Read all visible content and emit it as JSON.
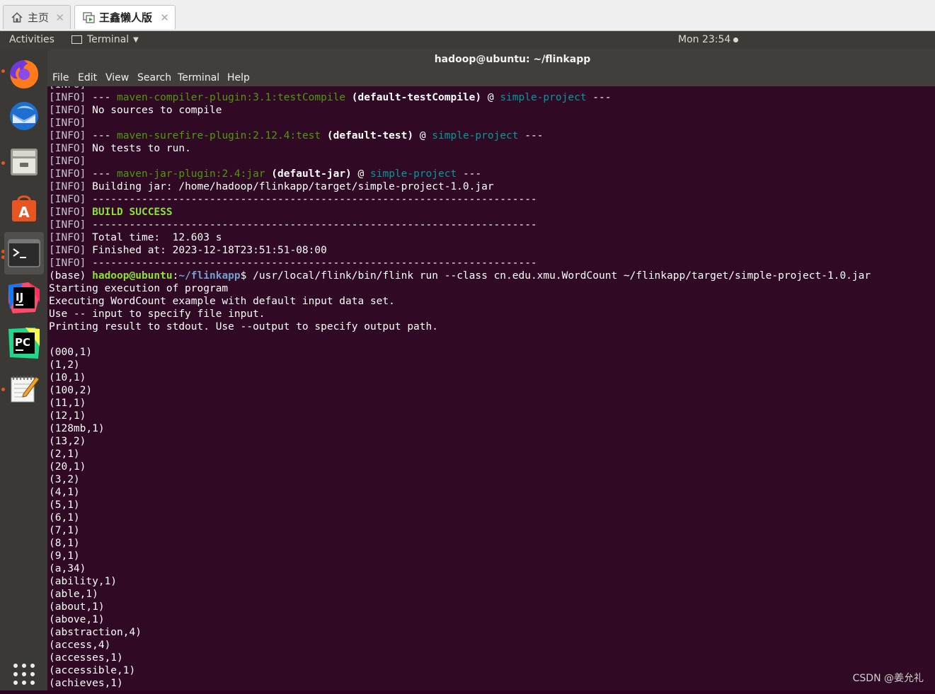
{
  "vm_tabs": [
    {
      "label": "主页",
      "icon": "home-icon",
      "active": false
    },
    {
      "label": "王鑫懒人版",
      "icon": "vm-icon",
      "active": true
    }
  ],
  "topbar": {
    "activities": "Activities",
    "app_name": "Terminal",
    "clock": "Mon 23:54"
  },
  "dock": [
    {
      "name": "firefox-icon",
      "running": true
    },
    {
      "name": "thunderbird-icon",
      "running": false
    },
    {
      "name": "files-icon",
      "running": true
    },
    {
      "name": "software-center-icon",
      "running": false
    },
    {
      "name": "terminal-icon",
      "running": true
    },
    {
      "name": "intellij-idea-icon",
      "running": false
    },
    {
      "name": "pycharm-icon",
      "running": false
    },
    {
      "name": "text-editor-icon",
      "running": true
    },
    {
      "name": "show-applications-icon",
      "running": false
    }
  ],
  "window": {
    "title": "hadoop@ubuntu: ~/flinkapp",
    "menu": [
      "File",
      "Edit",
      "View",
      "Search",
      "Terminal",
      "Help"
    ]
  },
  "terminal": {
    "lines": [
      [
        {
          "t": "[INFO]",
          "c": "info"
        }
      ],
      [
        {
          "t": "[INFO]",
          "c": "info"
        },
        {
          "t": " --- "
        },
        {
          "t": "maven-compiler-plugin:3.1:testCompile",
          "c": "green"
        },
        {
          "t": " "
        },
        {
          "t": "(default-testCompile)",
          "c": "bold"
        },
        {
          "t": " @ "
        },
        {
          "t": "simple-project",
          "c": "cyan"
        },
        {
          "t": " ---"
        }
      ],
      [
        {
          "t": "[INFO]",
          "c": "info"
        },
        {
          "t": " No sources to compile"
        }
      ],
      [
        {
          "t": "[INFO]",
          "c": "info"
        }
      ],
      [
        {
          "t": "[INFO]",
          "c": "info"
        },
        {
          "t": " --- "
        },
        {
          "t": "maven-surefire-plugin:2.12.4:test",
          "c": "green"
        },
        {
          "t": " "
        },
        {
          "t": "(default-test)",
          "c": "bold"
        },
        {
          "t": " @ "
        },
        {
          "t": "simple-project",
          "c": "cyan"
        },
        {
          "t": " ---"
        }
      ],
      [
        {
          "t": "[INFO]",
          "c": "info"
        },
        {
          "t": " No tests to run."
        }
      ],
      [
        {
          "t": "[INFO]",
          "c": "info"
        }
      ],
      [
        {
          "t": "[INFO]",
          "c": "info"
        },
        {
          "t": " --- "
        },
        {
          "t": "maven-jar-plugin:2.4:jar",
          "c": "green"
        },
        {
          "t": " "
        },
        {
          "t": "(default-jar)",
          "c": "bold"
        },
        {
          "t": " @ "
        },
        {
          "t": "simple-project",
          "c": "cyan"
        },
        {
          "t": " ---"
        }
      ],
      [
        {
          "t": "[INFO]",
          "c": "info"
        },
        {
          "t": " Building jar: /home/hadoop/flinkapp/target/simple-project-1.0.jar"
        }
      ],
      [
        {
          "t": "[INFO]",
          "c": "info"
        },
        {
          "t": " ------------------------------------------------------------------------"
        }
      ],
      [
        {
          "t": "[INFO]",
          "c": "info"
        },
        {
          "t": " "
        },
        {
          "t": "BUILD SUCCESS",
          "c": "succ"
        }
      ],
      [
        {
          "t": "[INFO]",
          "c": "info"
        },
        {
          "t": " ------------------------------------------------------------------------"
        }
      ],
      [
        {
          "t": "[INFO]",
          "c": "info"
        },
        {
          "t": " Total time:  12.603 s"
        }
      ],
      [
        {
          "t": "[INFO]",
          "c": "info"
        },
        {
          "t": " Finished at: 2023-12-18T23:51:51-08:00"
        }
      ],
      [
        {
          "t": "[INFO]",
          "c": "info"
        },
        {
          "t": " ------------------------------------------------------------------------"
        }
      ],
      [
        {
          "t": "(base) "
        },
        {
          "t": "hadoop@ubuntu",
          "c": "prompt-user"
        },
        {
          "t": ":"
        },
        {
          "t": "~/flinkapp",
          "c": "prompt-path"
        },
        {
          "t": "$ /usr/local/flink/bin/flink run --class cn.edu.xmu.WordCount ~/flinkapp/target/simple-project-1.0.jar"
        }
      ],
      [
        {
          "t": "Starting execution of program"
        }
      ],
      [
        {
          "t": "Executing WordCount example with default input data set."
        }
      ],
      [
        {
          "t": "Use -- input to specify file input."
        }
      ],
      [
        {
          "t": "Printing result to stdout. Use --output to specify output path."
        }
      ],
      [
        {
          "t": ""
        }
      ],
      [
        {
          "t": "(000,1)"
        }
      ],
      [
        {
          "t": "(1,2)"
        }
      ],
      [
        {
          "t": "(10,1)"
        }
      ],
      [
        {
          "t": "(100,2)"
        }
      ],
      [
        {
          "t": "(11,1)"
        }
      ],
      [
        {
          "t": "(12,1)"
        }
      ],
      [
        {
          "t": "(128mb,1)"
        }
      ],
      [
        {
          "t": "(13,2)"
        }
      ],
      [
        {
          "t": "(2,1)"
        }
      ],
      [
        {
          "t": "(20,1)"
        }
      ],
      [
        {
          "t": "(3,2)"
        }
      ],
      [
        {
          "t": "(4,1)"
        }
      ],
      [
        {
          "t": "(5,1)"
        }
      ],
      [
        {
          "t": "(6,1)"
        }
      ],
      [
        {
          "t": "(7,1)"
        }
      ],
      [
        {
          "t": "(8,1)"
        }
      ],
      [
        {
          "t": "(9,1)"
        }
      ],
      [
        {
          "t": "(a,34)"
        }
      ],
      [
        {
          "t": "(ability,1)"
        }
      ],
      [
        {
          "t": "(able,1)"
        }
      ],
      [
        {
          "t": "(about,1)"
        }
      ],
      [
        {
          "t": "(above,1)"
        }
      ],
      [
        {
          "t": "(abstraction,4)"
        }
      ],
      [
        {
          "t": "(access,4)"
        }
      ],
      [
        {
          "t": "(accesses,1)"
        }
      ],
      [
        {
          "t": "(accessible,1)"
        }
      ],
      [
        {
          "t": "(achieves,1)"
        }
      ]
    ]
  },
  "watermark": "CSDN @姜允礼",
  "colors": {
    "terminal_bg": "#300a24",
    "dock_bg": "#3a3935",
    "topbar_bg": "#3c3b37",
    "ubuntu_orange": "#e95420"
  }
}
